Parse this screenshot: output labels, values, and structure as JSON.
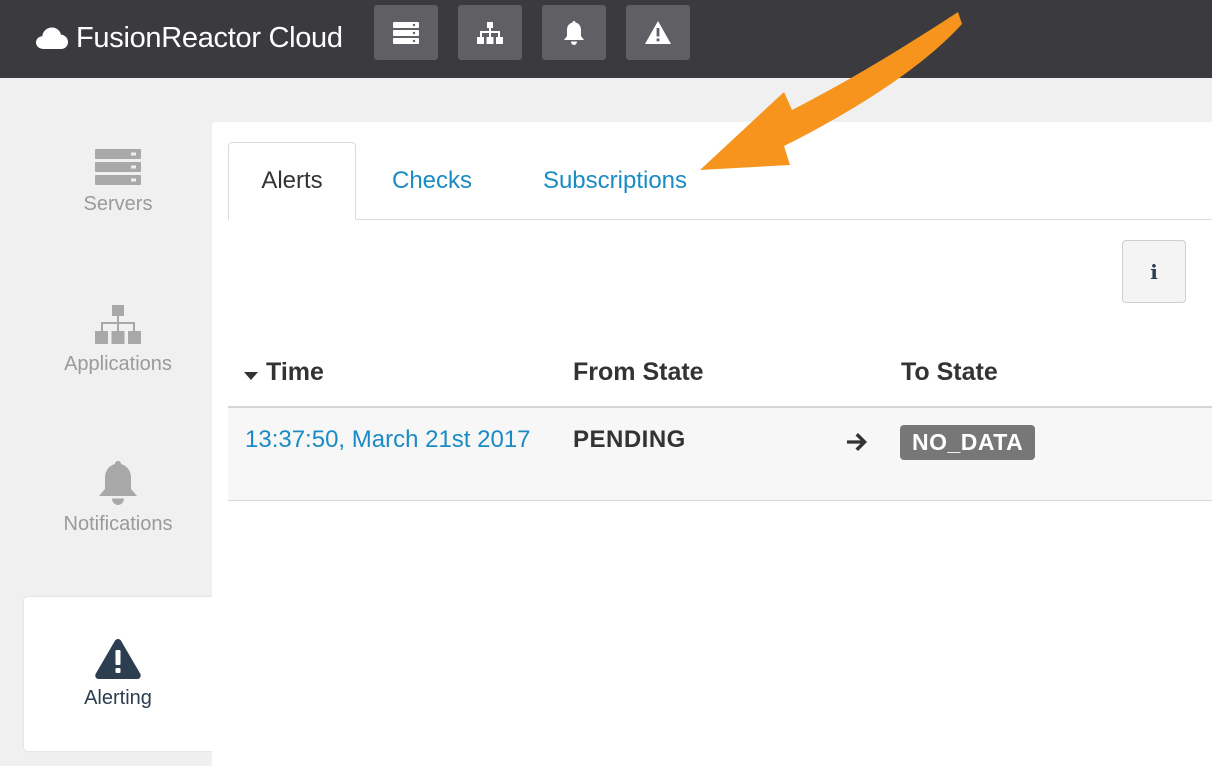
{
  "app": {
    "title": "FusionReactor Cloud",
    "logo_icon": "cloud-icon"
  },
  "topbar": {
    "buttons": [
      {
        "name": "servers",
        "icon": "server-stack-icon"
      },
      {
        "name": "applications",
        "icon": "sitemap-icon"
      },
      {
        "name": "notifications",
        "icon": "bell-icon"
      },
      {
        "name": "alerting",
        "icon": "warning-triangle-icon"
      }
    ]
  },
  "sidebar": {
    "items": [
      {
        "label": "Servers",
        "icon": "server-stack-icon",
        "active": false
      },
      {
        "label": "Applications",
        "icon": "sitemap-icon",
        "active": false
      },
      {
        "label": "Notifications",
        "icon": "bell-icon",
        "active": false
      },
      {
        "label": "Alerting",
        "icon": "warning-triangle-icon",
        "active": true
      }
    ]
  },
  "tabs": [
    {
      "label": "Alerts",
      "active": true
    },
    {
      "label": "Checks",
      "active": false
    },
    {
      "label": "Subscriptions",
      "active": false
    }
  ],
  "info_button": {
    "label": "i"
  },
  "table": {
    "columns": [
      {
        "label": "Time",
        "sorted": "desc"
      },
      {
        "label": "From State"
      },
      {
        "label": "To State"
      }
    ],
    "rows": [
      {
        "time": "13:37:50, March 21st 2017",
        "from_state": "PENDING",
        "to_state": "NO_DATA"
      }
    ]
  },
  "colors": {
    "topbar_bg": "#3a3a3f",
    "topbar_button": "#5f5f64",
    "link": "#1a8bc4",
    "badge_bg": "#777777",
    "annotation_arrow": "#f7941d",
    "active_icon": "#2c3e50"
  }
}
